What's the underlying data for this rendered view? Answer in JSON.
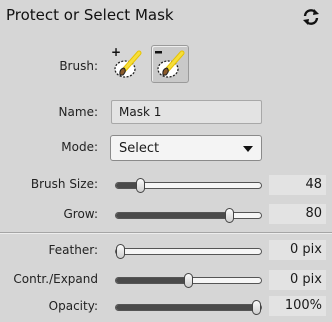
{
  "panel": {
    "title": "Protect or Select Mask"
  },
  "brush": {
    "label": "Brush:",
    "options": [
      {
        "icon": "brush-add-icon",
        "active": false
      },
      {
        "icon": "brush-subtract-icon",
        "active": true
      }
    ]
  },
  "name": {
    "label": "Name:",
    "value": "Mask 1"
  },
  "mode": {
    "label": "Mode:",
    "selected": "Select"
  },
  "sliders": [
    {
      "id": "brush-size",
      "label": "Brush Size:",
      "value": "48",
      "level": 0.15
    },
    {
      "id": "grow",
      "label": "Grow:",
      "value": "80",
      "level": 0.8
    },
    {
      "id": "feather",
      "label": "Feather:",
      "value": "0 pix",
      "level": 0.0
    },
    {
      "id": "contract-expand",
      "label": "Contr./Expand",
      "value": "0 pix",
      "level": 0.5
    },
    {
      "id": "opacity",
      "label": "Opacity:",
      "value": "100%",
      "level": 1.0
    }
  ],
  "colors": {
    "panel_bg": "#d6d6d6",
    "field_bg": "#e3e3e3",
    "track_fill": "#4a4a4a",
    "brush_icon_yellow": "#f2d51a"
  }
}
